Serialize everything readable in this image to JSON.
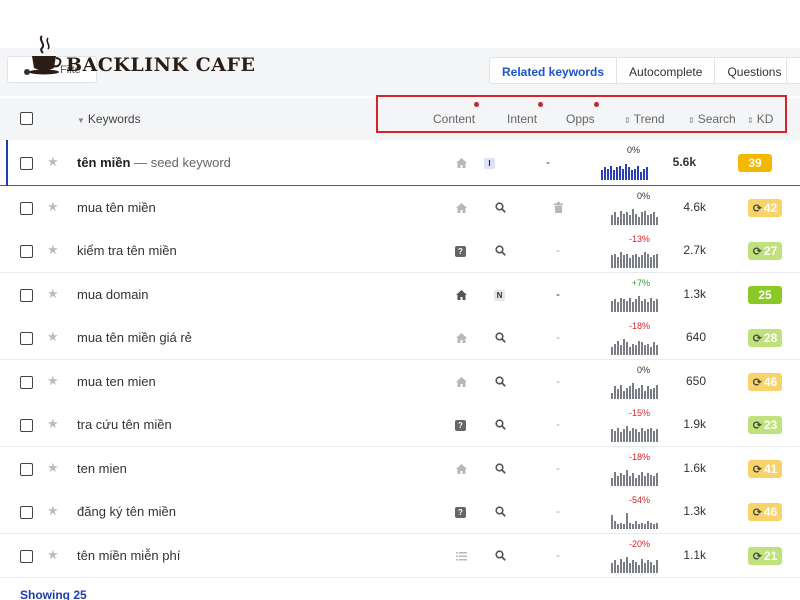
{
  "brand": {
    "name": "BACKLINK CAFE"
  },
  "toolbar": {
    "filter_label": "Filte"
  },
  "tabs": [
    {
      "label": "Related keywords",
      "active": true
    },
    {
      "label": "Autocomplete",
      "active": false
    },
    {
      "label": "Questions",
      "active": false
    }
  ],
  "columns": {
    "keywords": "Keywords",
    "content": "Content",
    "intent": "Intent",
    "opps": "Opps",
    "trend": "Trend",
    "search": "Search",
    "kd": "KD"
  },
  "seed_suffix": " — seed keyword",
  "rows": [
    {
      "keyword": "tên miền",
      "seed": true,
      "content_icon": "home-icon",
      "intent": "I",
      "intent_color": "#dde3f5",
      "opps": "-",
      "trend": "0%",
      "trend_color": "#333333",
      "bars": [
        0.6,
        0.8,
        0.7,
        0.9,
        0.6,
        0.8,
        0.9,
        0.7,
        1.0,
        0.8,
        0.6,
        0.7,
        0.9,
        0.5,
        0.7,
        0.8
      ],
      "bar_color": "#2a3fb3",
      "search": "5.6k",
      "kd": "39",
      "kd_color": "#f5b800",
      "kd_refresh": false
    },
    {
      "keyword": "mua tên miền",
      "content_icon": "home-icon",
      "intent": "search",
      "opps": "trash",
      "trend": "0%",
      "trend_color": "#333333",
      "bars": [
        0.6,
        0.8,
        0.5,
        0.9,
        0.7,
        0.8,
        0.6,
        1.0,
        0.7,
        0.5,
        0.8,
        0.9,
        0.6,
        0.7,
        0.8,
        0.5
      ],
      "search": "4.6k",
      "kd": "42",
      "kd_color": "#f7d36a",
      "kd_refresh": true
    },
    {
      "keyword": "kiểm tra tên miền",
      "content_icon": "question-icon",
      "intent": "search",
      "opps": "-",
      "trend": "-13%",
      "trend_color": "#d9232a",
      "bars": [
        0.8,
        0.9,
        0.7,
        1.0,
        0.8,
        0.9,
        0.6,
        0.8,
        0.9,
        0.7,
        0.8,
        1.0,
        0.9,
        0.7,
        0.8,
        0.9
      ],
      "search": "2.7k",
      "kd": "27",
      "kd_color": "#bfe27c",
      "kd_refresh": true
    },
    {
      "keyword": "mua domain",
      "content_icon": "home-icon-dark",
      "intent": "N",
      "intent_color": "#e5e6ea",
      "opps": "-",
      "trend": "+7%",
      "trend_color": "#2f9e3a",
      "bars": [
        0.7,
        0.8,
        0.6,
        0.9,
        0.8,
        0.7,
        0.9,
        0.6,
        0.8,
        1.0,
        0.7,
        0.8,
        0.6,
        0.9,
        0.7,
        0.8
      ],
      "search": "1.3k",
      "kd": "25",
      "kd_color": "#8ac926",
      "kd_refresh": false
    },
    {
      "keyword": "mua tên miền giá rẻ",
      "content_icon": "home-icon",
      "intent": "search",
      "opps": "-",
      "trend": "-18%",
      "trend_color": "#d9232a",
      "bars": [
        0.5,
        0.7,
        0.9,
        0.6,
        1.0,
        0.8,
        0.5,
        0.7,
        0.6,
        0.9,
        0.8,
        0.6,
        0.7,
        0.5,
        0.8,
        0.6
      ],
      "search": "640",
      "kd": "28",
      "kd_color": "#bfe27c",
      "kd_refresh": true
    },
    {
      "keyword": "mua ten mien",
      "content_icon": "home-icon",
      "intent": "search",
      "opps": "-",
      "trend": "0%",
      "trend_color": "#333333",
      "bars": [
        0.4,
        0.8,
        0.6,
        0.9,
        0.5,
        0.7,
        0.8,
        1.0,
        0.6,
        0.7,
        0.9,
        0.5,
        0.8,
        0.6,
        0.7,
        0.9
      ],
      "search": "650",
      "kd": "46",
      "kd_color": "#f7d36a",
      "kd_refresh": true
    },
    {
      "keyword": "tra cứu tên miền",
      "content_icon": "question-icon",
      "intent": "search",
      "opps": "-",
      "trend": "-15%",
      "trend_color": "#d9232a",
      "bars": [
        0.8,
        0.7,
        0.9,
        0.6,
        0.8,
        1.0,
        0.7,
        0.9,
        0.8,
        0.6,
        0.9,
        0.7,
        0.8,
        0.9,
        0.7,
        0.8
      ],
      "search": "1.9k",
      "kd": "23",
      "kd_color": "#bfe27c",
      "kd_refresh": true
    },
    {
      "keyword": "ten mien",
      "content_icon": "home-icon",
      "intent": "search",
      "opps": "-",
      "trend": "-18%",
      "trend_color": "#d9232a",
      "bars": [
        0.5,
        0.9,
        0.6,
        0.8,
        0.7,
        1.0,
        0.6,
        0.8,
        0.5,
        0.7,
        0.9,
        0.6,
        0.8,
        0.7,
        0.6,
        0.8
      ],
      "search": "1.6k",
      "kd": "41",
      "kd_color": "#f7d36a",
      "kd_refresh": true
    },
    {
      "keyword": "đăng ký tên miền",
      "content_icon": "question-icon",
      "intent": "search",
      "opps": "-",
      "trend": "-54%",
      "trend_color": "#d9232a",
      "bars": [
        0.9,
        0.5,
        0.3,
        0.4,
        0.3,
        1.0,
        0.4,
        0.3,
        0.5,
        0.3,
        0.4,
        0.3,
        0.5,
        0.4,
        0.3,
        0.4
      ],
      "search": "1.3k",
      "kd": "46",
      "kd_color": "#f7d36a",
      "kd_refresh": true
    },
    {
      "keyword": "tên miền miễn phí",
      "content_icon": "list-icon",
      "intent": "search",
      "opps": "-",
      "trend": "-20%",
      "trend_color": "#d9232a",
      "bars": [
        0.6,
        0.8,
        0.5,
        0.9,
        0.7,
        1.0,
        0.6,
        0.8,
        0.7,
        0.5,
        0.9,
        0.6,
        0.8,
        0.7,
        0.5,
        0.8
      ],
      "search": "1.1k",
      "kd": "21",
      "kd_color": "#bfe27c",
      "kd_refresh": true
    }
  ],
  "footer": {
    "showing": "Showing 25"
  },
  "colors": {
    "accent": "#1a56c9",
    "highlight": "#d9232a",
    "seed_accent": "#1d3bb8"
  }
}
